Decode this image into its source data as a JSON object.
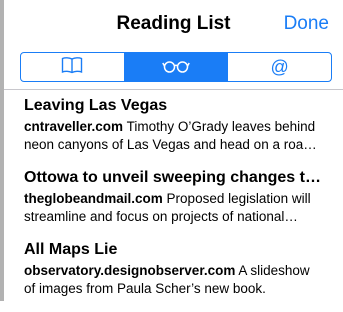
{
  "header": {
    "title": "Reading List",
    "done_label": "Done"
  },
  "segmented_control": {
    "segments": [
      {
        "icon": "book-icon",
        "selected": false
      },
      {
        "icon": "glasses-icon",
        "selected": true
      },
      {
        "icon": "at-sign-icon",
        "glyph": "@",
        "selected": false
      }
    ]
  },
  "items": [
    {
      "title": "Leaving Las Vegas",
      "source": "cntraveller.com",
      "summary": "Timothy O’Grady leaves behind neon canyons of Las Vegas and head on a road trip to N…"
    },
    {
      "title": "Ottowa to unveil sweeping changes to envi…",
      "source": "theglobeandmail.com",
      "summary": "Proposed legislation will streamline and focus on projects of national econo…"
    },
    {
      "title": "All Maps Lie",
      "source": "observatory.designobserver.com",
      "summary": "A slideshow of images from Paula Scher’s new book."
    }
  ],
  "colors": {
    "accent": "#1a7df6",
    "divider": "#c8c7cc",
    "text": "#000000"
  }
}
